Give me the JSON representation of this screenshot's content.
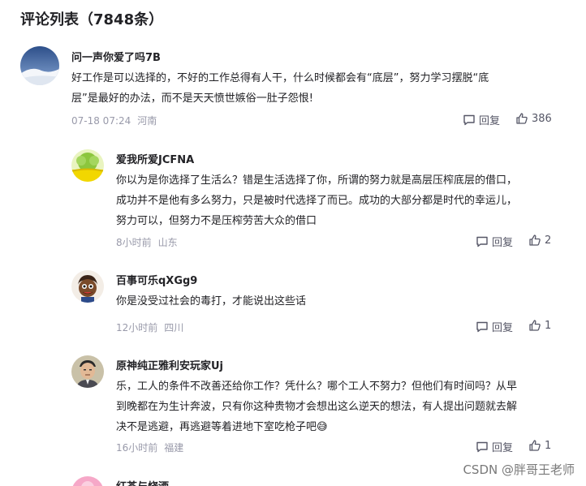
{
  "header": {
    "title": "评论列表（7848条）"
  },
  "comments": [
    {
      "user": "问一声你爱了吗7B",
      "lines": [
        "好工作是可以选择的，不好的工作总得有人干，什么时候都会有“底层”，努力学习摆脱“底",
        "层”是最好的办法，而不是天天愤世嫉俗一肚子怨恨!"
      ],
      "time": "07-18 07:24",
      "location": "河南",
      "reply_label": "回复",
      "likes": "386"
    },
    {
      "user": "爱我所爱JCFNA",
      "lines": [
        "你以为是你选择了生活么？错是生活选择了你，所谓的努力就是高层压榨底层的借口，",
        "成功并不是他有多么努力，只是被时代选择了而已。成功的大部分都是时代的幸运儿，",
        "努力可以，但努力不是压榨劳苦大众的借口"
      ],
      "time": "8小时前",
      "location": "山东",
      "reply_label": "回复",
      "likes": "2"
    },
    {
      "user": "百事可乐qXGg9",
      "lines": [
        "你是没受过社会的毒打，才能说出这些话"
      ],
      "time": "12小时前",
      "location": "四川",
      "reply_label": "回复",
      "likes": "1"
    },
    {
      "user": "原神纯正雅利安玩家Uj",
      "lines": [
        "乐，工人的条件不改善还给你工作？凭什么？哪个工人不努力？但他们有时间吗？从早",
        "到晚都在为生计奔波，只有你这种贵物才会想出这么逆天的想法，有人提出问题就去解",
        "决不是逃避，再逃避等着进地下室吃枪子吧😅"
      ],
      "time": "16小时前",
      "location": "福建",
      "reply_label": "回复",
      "likes": "1"
    },
    {
      "user": "红茶与烧酒"
    }
  ],
  "watermark": "CSDN @胖哥王老师"
}
